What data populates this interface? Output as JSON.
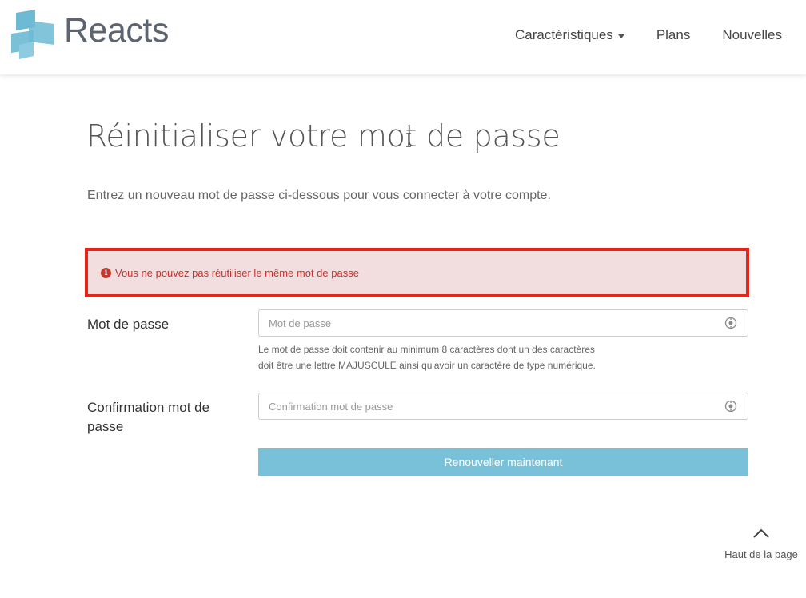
{
  "brand": {
    "name": "Reacts",
    "logo_color": "#6cbad4"
  },
  "nav": {
    "items": [
      {
        "label": "Caractéristiques",
        "has_dropdown": true
      },
      {
        "label": "Plans",
        "has_dropdown": false
      },
      {
        "label": "Nouvelles",
        "has_dropdown": false
      }
    ]
  },
  "main": {
    "title": "Réinitialiser votre mot de passe",
    "intro": "Entrez un nouveau mot de passe ci-dessous pour vous connecter à votre compte.",
    "alert": {
      "icon": "info-circle-icon",
      "text": "Vous ne pouvez pas réutiliser le même mot de passe",
      "bg_color": "#f2dede",
      "border_color": "#e3261b",
      "text_color": "#c9302c"
    },
    "password": {
      "label": "Mot de passe",
      "placeholder": "Mot de passe",
      "value": "",
      "help_line1": "Le mot de passe doit contenir au minimum 8 caractères dont un des caractères",
      "help_line2": "doit être une lettre MAJUSCULE ainsi qu'avoir un caractère de type numérique."
    },
    "confirm": {
      "label": "Confirmation mot de passe",
      "placeholder": "Confirmation mot de passe",
      "value": ""
    },
    "submit_label": "Renouveller maintenant",
    "submit_color": "#79c1d9"
  },
  "footer": {
    "back_to_top": "Haut de la page"
  }
}
